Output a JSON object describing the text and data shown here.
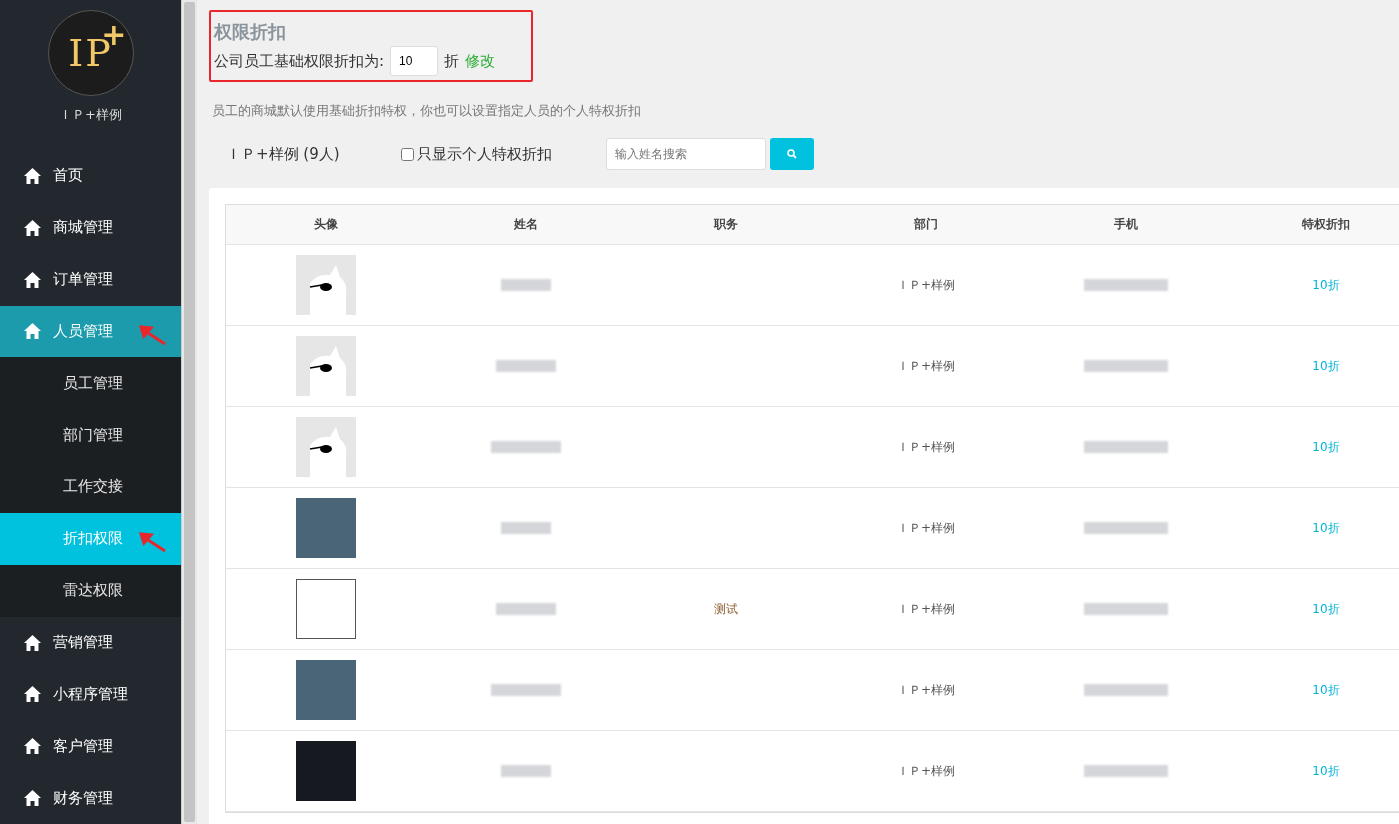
{
  "sidebar": {
    "logo": {
      "letters": "IP",
      "mark": "+"
    },
    "brand": "ＩＰ+样例",
    "items": [
      {
        "label": "首页",
        "kind": "main",
        "selected": false,
        "pointer": false
      },
      {
        "label": "商城管理",
        "kind": "main",
        "selected": false,
        "pointer": false
      },
      {
        "label": "订单管理",
        "kind": "main",
        "selected": false,
        "pointer": false
      },
      {
        "label": "人员管理",
        "kind": "main",
        "selected": true,
        "pointer": true
      },
      {
        "label": "员工管理",
        "kind": "sub",
        "selected": false,
        "pointer": false
      },
      {
        "label": "部门管理",
        "kind": "sub",
        "selected": false,
        "pointer": false
      },
      {
        "label": "工作交接",
        "kind": "sub",
        "selected": false,
        "pointer": false
      },
      {
        "label": "折扣权限",
        "kind": "sub",
        "selected": true,
        "pointer": true
      },
      {
        "label": "雷达权限",
        "kind": "sub",
        "selected": false,
        "pointer": false
      },
      {
        "label": "营销管理",
        "kind": "main",
        "selected": false,
        "pointer": false
      },
      {
        "label": "小程序管理",
        "kind": "main",
        "selected": false,
        "pointer": false
      },
      {
        "label": "客户管理",
        "kind": "main",
        "selected": false,
        "pointer": false
      },
      {
        "label": "财务管理",
        "kind": "main",
        "selected": false,
        "pointer": false
      }
    ]
  },
  "discount_box": {
    "title": "权限折扣",
    "label": "公司员工基础权限折扣为:",
    "value": "10",
    "unit": "折",
    "edit_link": "修改"
  },
  "hint": "员工的商城默认使用基础折扣特权，你也可以设置指定人员的个人特权折扣",
  "filter": {
    "company": "ＩＰ+样例 (9人)",
    "checkbox_label": "只显示个人特权折扣",
    "checked": false,
    "search_placeholder": "输入姓名搜索"
  },
  "table": {
    "columns": [
      "头像",
      "姓名",
      "职务",
      "部门",
      "手机",
      "特权折扣"
    ],
    "rows": [
      {
        "kind": "cartoon",
        "department": "ＩＰ+样例",
        "discount": "10折"
      },
      {
        "kind": "cartoon",
        "department": "ＩＰ+样例",
        "discount": "10折"
      },
      {
        "kind": "cartoon",
        "department": "ＩＰ+样例",
        "discount": "10折"
      },
      {
        "kind": "photo",
        "department": "ＩＰ+样例",
        "discount": "10折"
      },
      {
        "kind": "blank",
        "position": "测试",
        "department": "ＩＰ+样例",
        "discount": "10折"
      },
      {
        "kind": "photo",
        "department": "ＩＰ+样例",
        "discount": "10折"
      },
      {
        "kind": "dark",
        "department": "ＩＰ+样例",
        "discount": "10折"
      }
    ]
  }
}
